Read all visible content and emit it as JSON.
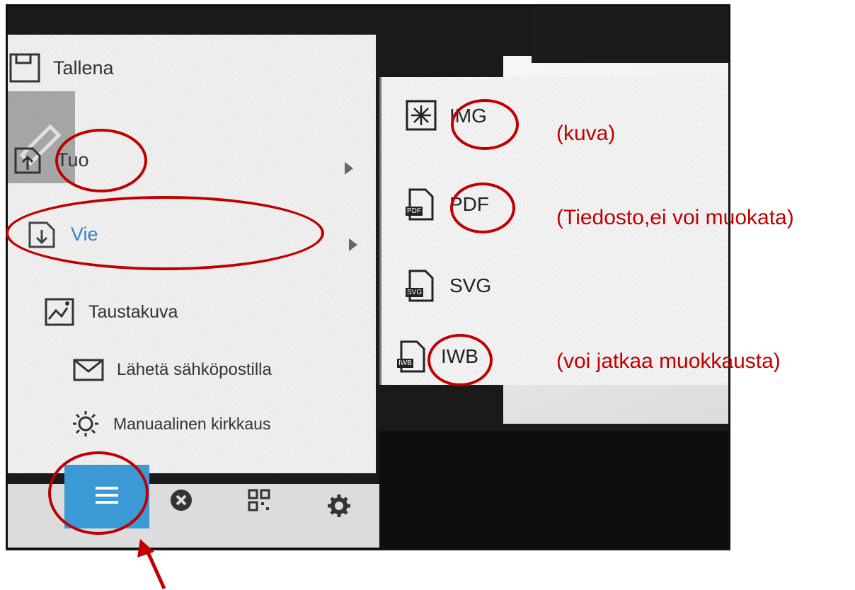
{
  "menu": {
    "items": [
      {
        "label": "Tallena",
        "icon": "save-icon"
      },
      {
        "label": "Tuo",
        "icon": "import-icon"
      },
      {
        "label": "Vie",
        "icon": "export-icon"
      },
      {
        "label": "Taustakuva",
        "icon": "background-image-icon"
      },
      {
        "label": "Lähetä sähköpostilla",
        "icon": "mail-icon"
      },
      {
        "label": "Manuaalinen kirkkaus",
        "icon": "brightness-icon"
      }
    ]
  },
  "submenu": {
    "items": [
      {
        "label": "IMG",
        "icon": "image-file-icon"
      },
      {
        "label": "PDF",
        "icon": "pdf-file-icon",
        "badge": "PDF"
      },
      {
        "label": "SVG",
        "icon": "svg-file-icon",
        "badge": "SVG"
      },
      {
        "label": "IWB",
        "icon": "iwb-file-icon",
        "badge": "IWB"
      }
    ]
  },
  "annotations": {
    "img": "(kuva)",
    "pdf": "(Tiedosto,ei voi muokata)",
    "iwb": "(voi jatkaa muokkausta)"
  },
  "toolbar": {
    "buttons": [
      {
        "icon": "hamburger-menu-icon"
      },
      {
        "icon": "close-circle-icon"
      },
      {
        "icon": "qr-code-icon"
      },
      {
        "icon": "gear-icon"
      }
    ]
  },
  "colors": {
    "annotation_red": "#c00000",
    "menu_button_blue": "#3b99d6"
  }
}
